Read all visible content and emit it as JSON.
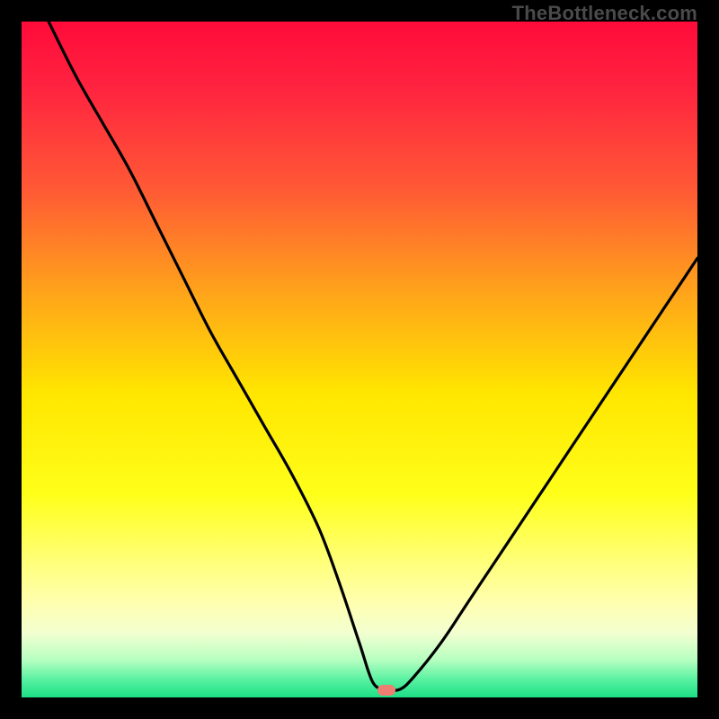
{
  "watermark": "TheBottleneck.com",
  "colors": {
    "frame": "#000000",
    "curve": "#000000",
    "marker": "#ef7e72",
    "gradient_stops": [
      {
        "offset": 0.0,
        "color": "#ff0b3a"
      },
      {
        "offset": 0.1,
        "color": "#ff2440"
      },
      {
        "offset": 0.25,
        "color": "#ff5a35"
      },
      {
        "offset": 0.4,
        "color": "#ffa31a"
      },
      {
        "offset": 0.55,
        "color": "#ffe600"
      },
      {
        "offset": 0.7,
        "color": "#ffff1a"
      },
      {
        "offset": 0.8,
        "color": "#ffff7a"
      },
      {
        "offset": 0.86,
        "color": "#ffffb0"
      },
      {
        "offset": 0.905,
        "color": "#f2ffd0"
      },
      {
        "offset": 0.945,
        "color": "#b5ffc0"
      },
      {
        "offset": 0.975,
        "color": "#55f0a0"
      },
      {
        "offset": 1.0,
        "color": "#1cdf86"
      }
    ]
  },
  "chart_data": {
    "type": "line",
    "title": "",
    "xlabel": "",
    "ylabel": "",
    "xlim": [
      0,
      100
    ],
    "ylim": [
      0,
      100
    ],
    "grid": false,
    "marker": {
      "x": 54,
      "y": 1
    },
    "series": [
      {
        "name": "bottleneck-curve",
        "x": [
          4,
          8,
          12,
          16,
          20,
          24,
          28,
          32,
          36,
          40,
          44,
          47,
          50,
          52,
          54,
          56,
          58,
          62,
          66,
          70,
          74,
          78,
          82,
          86,
          90,
          94,
          98,
          100
        ],
        "y": [
          100,
          92,
          85,
          78,
          70,
          62,
          54,
          47,
          40,
          33,
          25,
          17,
          8,
          2.2,
          1.2,
          1.2,
          3,
          8,
          14,
          20,
          26,
          32,
          38,
          44,
          50,
          56,
          62,
          65
        ]
      }
    ]
  }
}
